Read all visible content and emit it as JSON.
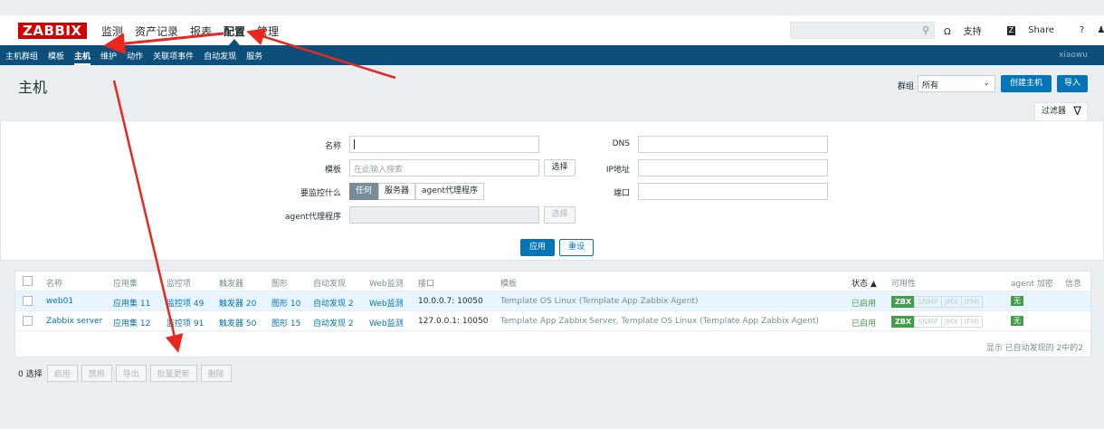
{
  "topbar": {
    "logo": "ZABBIX",
    "menu": [
      "监测",
      "资产记录",
      "报表",
      "配置",
      "管理"
    ],
    "active_menu": "配置",
    "support": "支持",
    "share": "Share",
    "help": "?",
    "share_badge": "Z"
  },
  "subbar": {
    "items": [
      "主机群组",
      "模板",
      "主机",
      "维护",
      "动作",
      "关联项事件",
      "自动发现",
      "服务"
    ],
    "active_item": "主机",
    "username": "xiaowu"
  },
  "page": {
    "title": "主机",
    "group_label": "群组",
    "group_value": "所有",
    "create_button": "创建主机",
    "import_button": "导入"
  },
  "filter": {
    "tab_label": "过滤器",
    "name_label": "名称",
    "name_value": "",
    "template_label": "模板",
    "template_placeholder": "在此输入搜索",
    "select_button": "选择",
    "monitor_label": "要监控什么",
    "monitor_options": [
      "任何",
      "服务器",
      "agent代理程序"
    ],
    "monitor_selected": "任何",
    "agent_label": "agent代理程序",
    "agent_select_button": "选择",
    "dns_label": "DNS",
    "ip_label": "IP地址",
    "port_label": "端口",
    "apply_button": "应用",
    "reset_button": "重设"
  },
  "table": {
    "headers": {
      "name": "名称",
      "apps": "应用集",
      "items": "监控项",
      "triggers": "触发器",
      "graphs": "图形",
      "discovery": "自动发现",
      "web": "Web监测",
      "interface": "接口",
      "templates": "模板",
      "status": "状态 ▲",
      "availability": "可用性",
      "agent_encryption": "agent 加密",
      "info": "信息"
    },
    "rows": [
      {
        "name": "web01",
        "apps": "应用集 11",
        "items": "监控项 49",
        "triggers": "触发器 20",
        "graphs": "图形 10",
        "discovery": "自动发现 2",
        "web": "Web监测",
        "interface": "10.0.0.7: 10050",
        "templates": "Template OS Linux (Template App Zabbix Agent)",
        "status": "已启用",
        "avail": [
          "ZBX",
          "SNMP",
          "JMX",
          "IPMI"
        ],
        "encryption": "无"
      },
      {
        "name": "Zabbix server",
        "apps": "应用集 12",
        "items": "监控项 91",
        "triggers": "触发器 50",
        "graphs": "图形 15",
        "discovery": "自动发现 2",
        "web": "Web监测",
        "interface": "127.0.0.1: 10050",
        "templates": "Template App Zabbix Server, Template OS Linux (Template App Zabbix Agent)",
        "status": "已启用",
        "avail": [
          "ZBX",
          "SNMP",
          "JMX",
          "IPMI"
        ],
        "encryption": "无"
      }
    ],
    "footer": "显示 已自动发现的 2中的2"
  },
  "actions": {
    "selected": "0 选择",
    "buttons": [
      "启用",
      "禁用",
      "导出",
      "批量更新",
      "删除"
    ]
  },
  "colors": {
    "brand": "#d40000",
    "nav": "#0b4f7a",
    "accent": "#0275b8",
    "green": "#429e47",
    "annotation": "#e8281e"
  }
}
